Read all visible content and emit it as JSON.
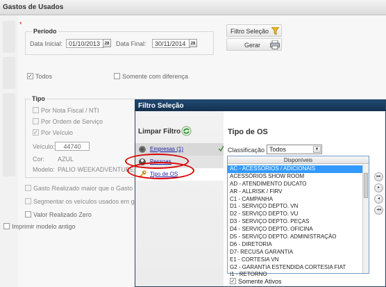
{
  "window": {
    "title": "Gastos de Usados"
  },
  "periodo": {
    "legend": "Período",
    "data_inicial_label": "Data Inicial:",
    "data_inicial_value": "01/10/2013",
    "data_final_label": "Data Final:",
    "data_final_value": "30/11/2014",
    "cal_glyph": "28"
  },
  "buttons": {
    "filtro_selecao": "Filtro Seleção",
    "gerar": "Gerar"
  },
  "opts": {
    "todos": "Todos",
    "somente_diferenca": "Somente com diferença"
  },
  "tipo": {
    "legend": "Tipo",
    "nota_fiscal": "Por Nota Fiscal / NTI",
    "ordem_servico": "Por Ordem de Serviço",
    "veiculo": "Por Veículo",
    "veiculo_label": "Veículo:",
    "veiculo_value": "44740",
    "cor_label": "Cor:",
    "cor_value": "AZUL",
    "modelo_label": "Modelo:",
    "modelo_value": "PALIO WEEKADVENTURE"
  },
  "checks": {
    "gasto_realizado": "Gasto Realizado maior que o Gasto Pr",
    "segmentar": "Segmentar os veículos usados em gru",
    "valor_zero": "Valor Realizado Zero",
    "imprimir": "Imprimir modelo antigo"
  },
  "dialog": {
    "title": "Filtro Seleção",
    "limpar_filtro": "Limpar Filtro",
    "nav": [
      {
        "label": "Empresas (1)"
      },
      {
        "label": "Pessoas"
      },
      {
        "label": "Tipo de OS"
      }
    ],
    "section_title": "Tipo de OS",
    "classificacao_label": "Classificação",
    "classificacao_value": "Todos",
    "list_header": "Disponíveis",
    "list_items": [
      "AC - ACESSÓRIOS / ADICIONAIS",
      "ACESSÓRIOS SHOW ROOM",
      "AD - ATENDIMENTO DUCATO",
      "AR - ALLRISK / FIRV",
      "C1 - CAMPANHA",
      "D1 - SERVIÇO DEPTO. VN",
      "D2 - SERVIÇO DEPTO. VU",
      "D3 - SERVIÇO DEPTO. PEÇAS",
      "D4 - SERVIÇO DEPTO. OFICINA",
      "D5 - SERVIÇO DEPTO. ADMINISTRAÇÃO",
      "D6 - DIRETORIA",
      "D7- RECUSA GARANTIA",
      "E1 - CORTESIA VN",
      "G2 - GARANTIA ESTENDIDA CORTESIA FIAT",
      "I1 - RETORNO"
    ],
    "somente_ativos": "Somente Ativos",
    "move_buttons": [
      "▸▸",
      "▸",
      "◂",
      "◂◂"
    ]
  }
}
